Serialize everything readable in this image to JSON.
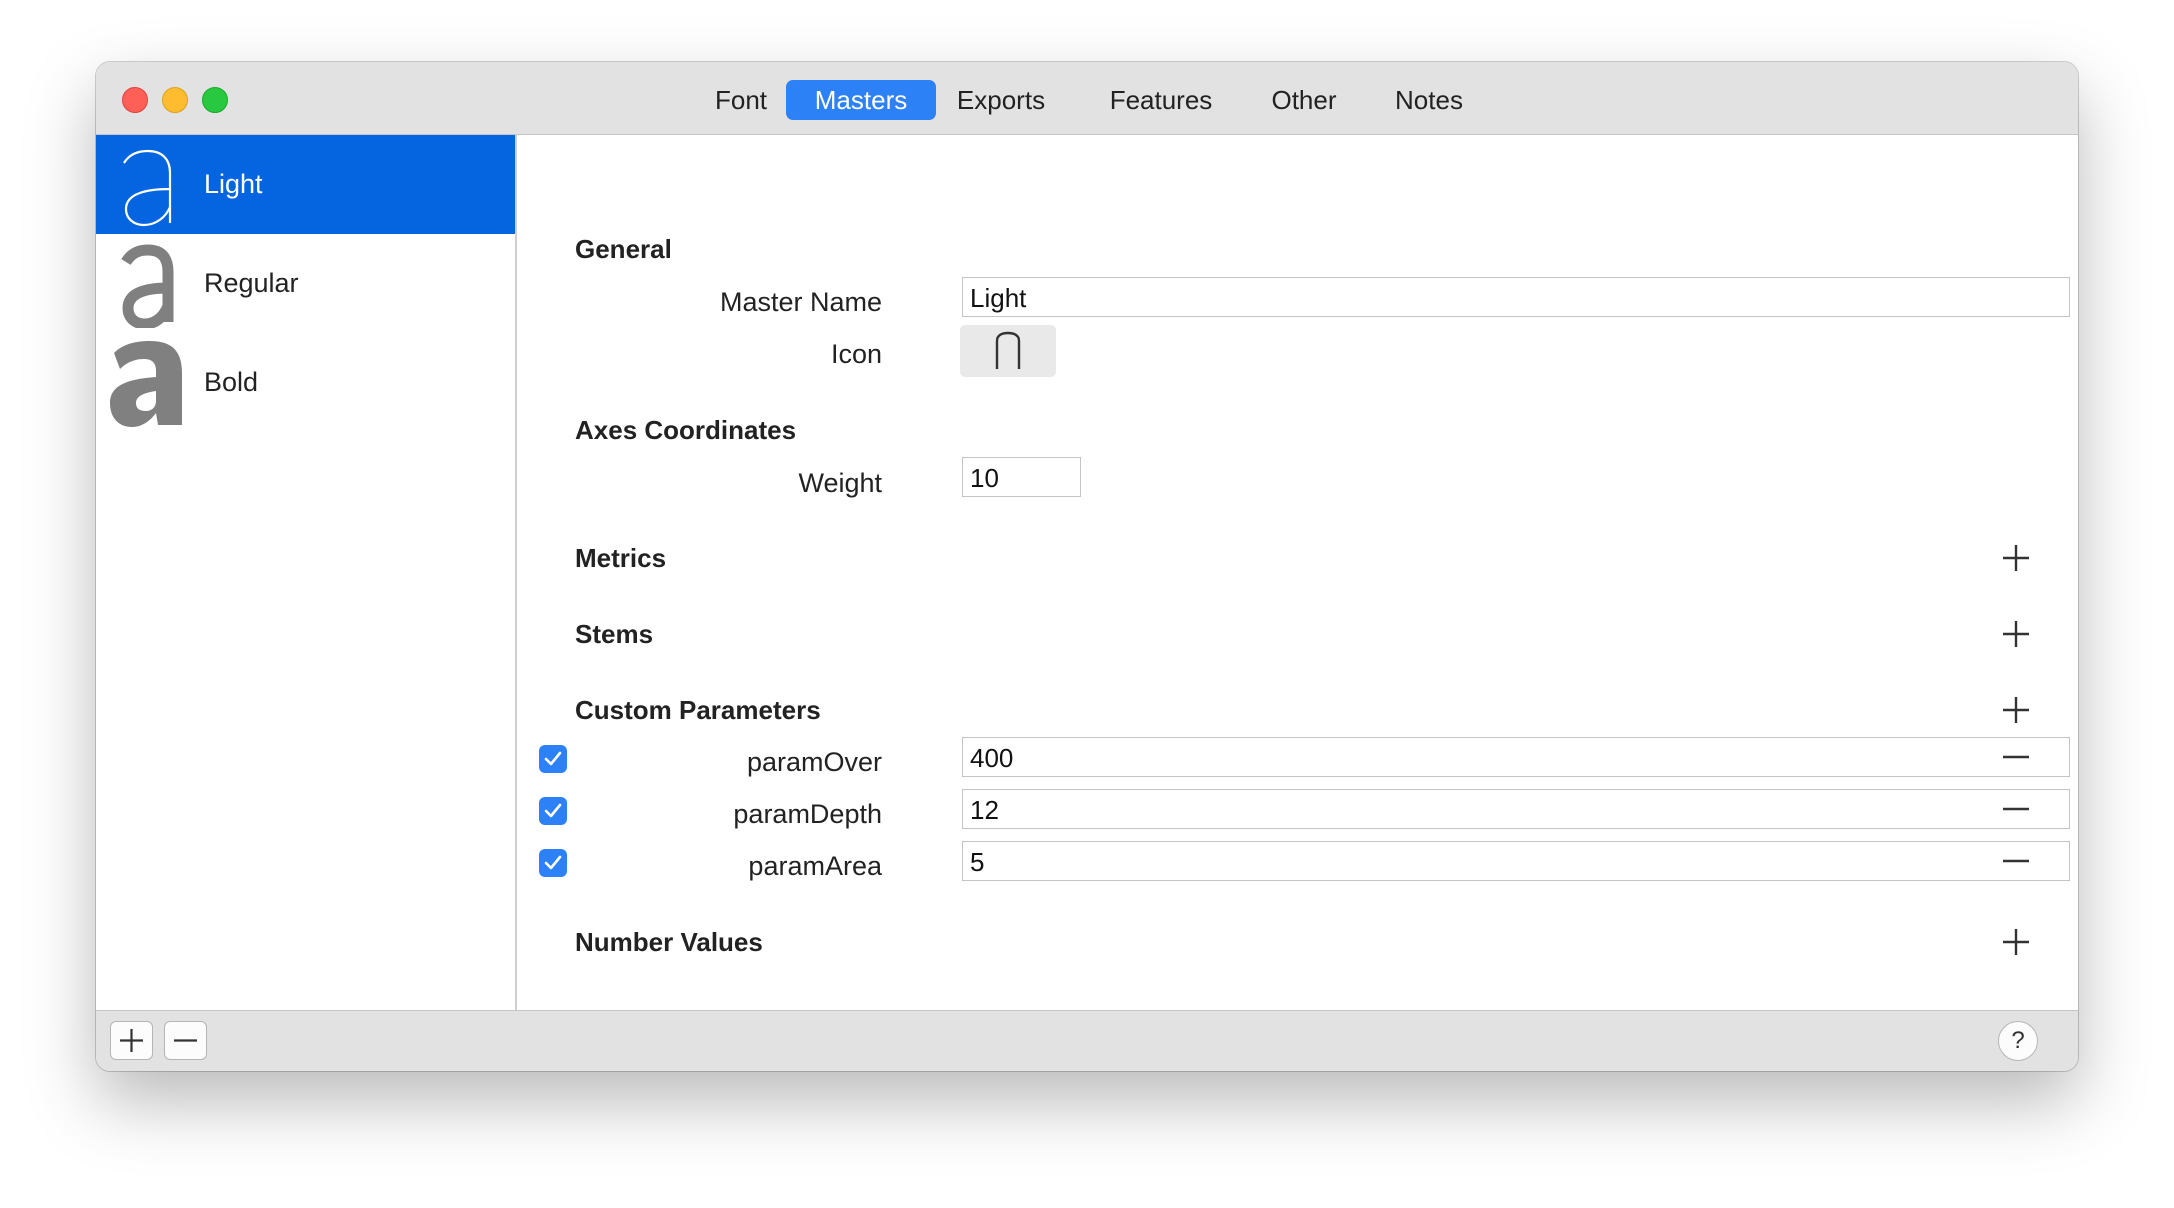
{
  "tabs": [
    {
      "label": "Font"
    },
    {
      "label": "Masters",
      "active": true
    },
    {
      "label": "Exports"
    },
    {
      "label": "Features"
    },
    {
      "label": "Other"
    },
    {
      "label": "Notes"
    }
  ],
  "sidebar": {
    "items": [
      {
        "label": "Light",
        "selected": true
      },
      {
        "label": "Regular"
      },
      {
        "label": "Bold"
      }
    ]
  },
  "general": {
    "title": "General",
    "master_name_label": "Master Name",
    "master_name_value": "Light",
    "icon_label": "Icon"
  },
  "axes": {
    "title": "Axes Coordinates",
    "weight_label": "Weight",
    "weight_value": "10"
  },
  "metrics": {
    "title": "Metrics"
  },
  "stems": {
    "title": "Stems"
  },
  "custom_parameters": {
    "title": "Custom Parameters",
    "rows": [
      {
        "name": "paramOver",
        "value": "400",
        "enabled": true
      },
      {
        "name": "paramDepth",
        "value": "12",
        "enabled": true
      },
      {
        "name": "paramArea",
        "value": "5",
        "enabled": true
      }
    ]
  },
  "number_values": {
    "title": "Number Values"
  },
  "bottom": {
    "help_label": "?"
  },
  "colors": {
    "accent": "#2d81f7",
    "selection": "#0565e0",
    "close": "#fe5f57",
    "minimize": "#febc2e",
    "zoom": "#28c840"
  }
}
